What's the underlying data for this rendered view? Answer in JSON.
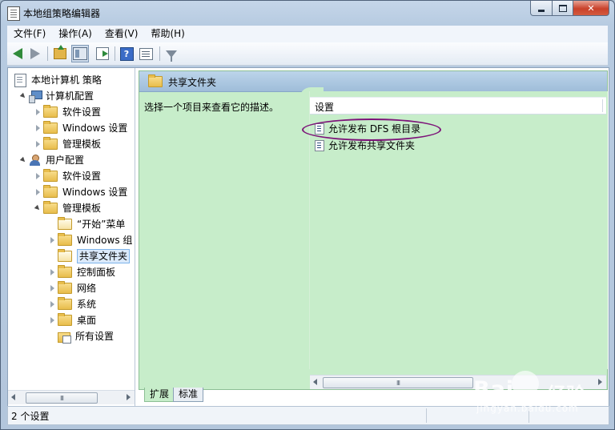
{
  "window": {
    "title": "本地组策略编辑器",
    "controls": {
      "minimize": "",
      "maximize": "",
      "close": "✕"
    }
  },
  "menu": [
    "文件(F)",
    "操作(A)",
    "查看(V)",
    "帮助(H)"
  ],
  "toolbar": {
    "icons": [
      "back-arrow-icon",
      "forward-arrow-icon",
      "up-folder-icon",
      "show-tree-icon",
      "export-icon",
      "help-icon",
      "properties-icon",
      "filter-icon"
    ],
    "help_glyph": "?"
  },
  "tree": {
    "root": "本地计算机 策略",
    "computer_config": {
      "label": "计算机配置",
      "children": [
        "软件设置",
        "Windows 设置",
        "管理模板"
      ]
    },
    "user_config": {
      "label": "用户配置",
      "children": [
        "软件设置",
        "Windows 设置",
        "管理模板"
      ],
      "admin_templates_children": [
        "“开始”菜单",
        "Windows 组",
        "共享文件夹",
        "控制面板",
        "网络",
        "系统",
        "桌面",
        "所有设置"
      ]
    },
    "selected": "共享文件夹",
    "scroll_thumb": "III"
  },
  "right_pane": {
    "header": "共享文件夹",
    "description": "选择一个项目来查看它的描述。",
    "column_header": "设置",
    "items": [
      "允许发布 DFS 根目录",
      "允许发布共享文件夹"
    ],
    "highlighted_item": "允许发布 DFS 根目录",
    "scroll_thumb": "III"
  },
  "tabs": [
    "扩展",
    "标准"
  ],
  "active_tab": "扩展",
  "status": {
    "text": "2 个设置"
  },
  "watermark": {
    "brand": "Bai",
    "brand_cn": "经验",
    "url": "jingyan.baidu.com"
  },
  "colors": {
    "pane_green": "#c7edca",
    "highlight_ring": "#7d1479",
    "selection": "#dbeafb"
  }
}
